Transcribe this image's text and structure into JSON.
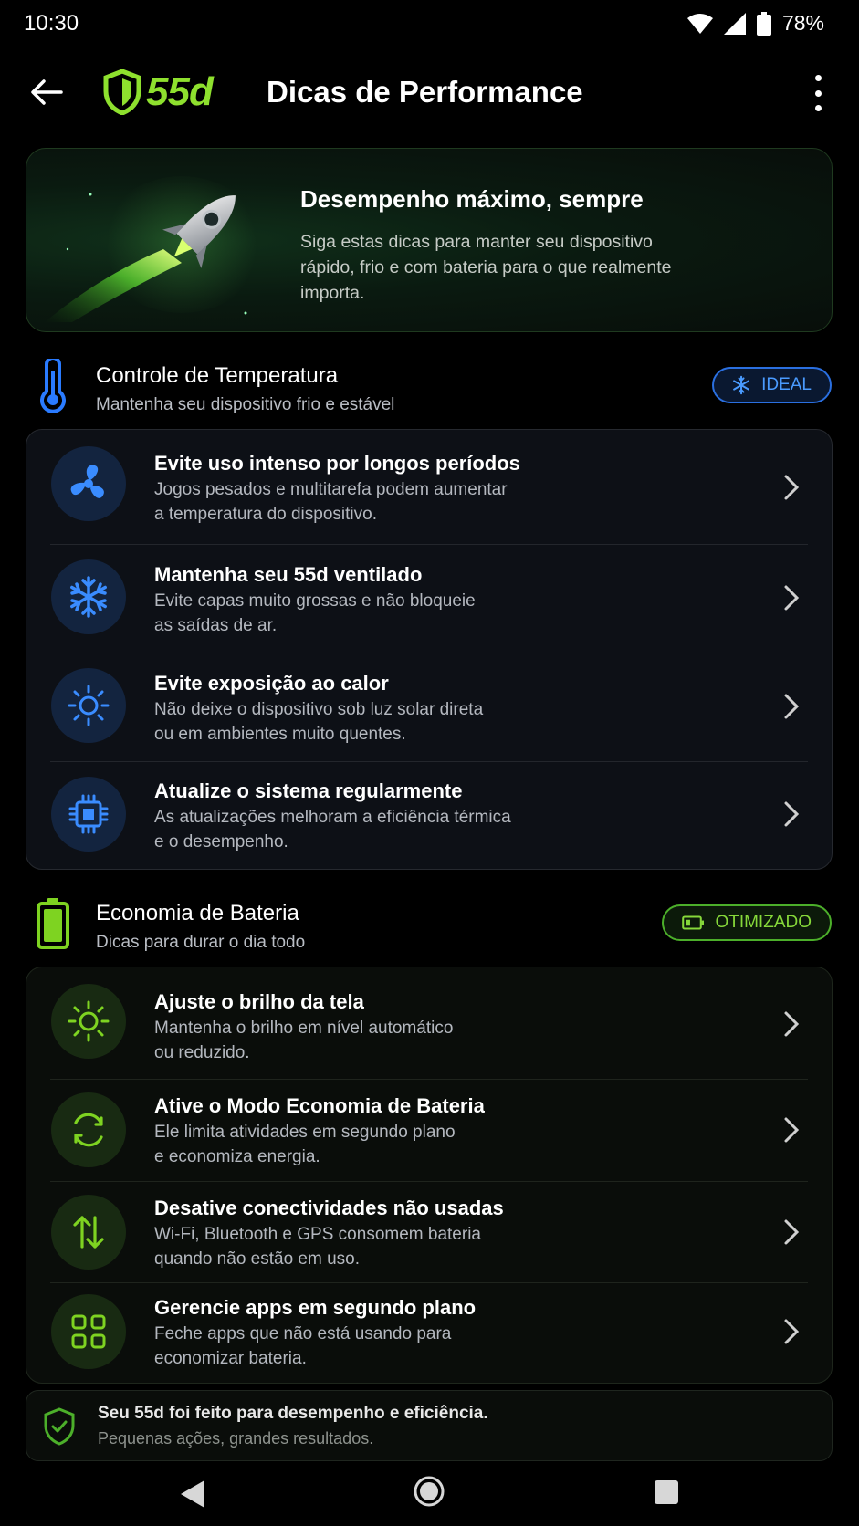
{
  "status_bar": {
    "time": "10:30",
    "battery": "78%"
  },
  "header": {
    "logo_text": "55d",
    "title": "Dicas de Performance"
  },
  "hero": {
    "title": "Desempenho máximo, sempre",
    "description": "Siga estas dicas para manter seu dispositivo rápido, frio e com bateria para o que realmente importa."
  },
  "temperature": {
    "title": "Controle de Temperatura",
    "subtitle": "Mantenha seu dispositivo frio e estável",
    "badge": "IDEAL",
    "accent": "#2a7bff",
    "items": [
      {
        "icon": "fan-icon",
        "title": "Evite uso intenso por longos períodos",
        "desc1": "Jogos pesados e multitarefa podem aumentar",
        "desc2": "a temperatura do dispositivo."
      },
      {
        "icon": "snowflake-icon",
        "title": "Mantenha seu 55d ventilado",
        "desc1": "Evite capas muito grossas e não bloqueie",
        "desc2": "as saídas de ar."
      },
      {
        "icon": "sun-icon",
        "title": "Evite exposição ao calor",
        "desc1": "Não deixe o dispositivo sob luz solar direta",
        "desc2": "ou em ambientes muito quentes."
      },
      {
        "icon": "chip-icon",
        "title": "Atualize o sistema regularmente",
        "desc1": "As atualizações melhoram a eficiência térmica",
        "desc2": "e o desempenho."
      }
    ]
  },
  "battery": {
    "title": "Economia de Bateria",
    "subtitle": "Dicas para durar o dia todo",
    "badge": "OTIMIZADO",
    "accent": "#7ed321",
    "items": [
      {
        "icon": "brightness-icon",
        "title": "Ajuste o brilho da tela",
        "desc1": "Mantenha o brilho em nível automático",
        "desc2": "ou reduzido."
      },
      {
        "icon": "sync-icon",
        "title": "Ative o Modo Economia de Bateria",
        "desc1": "Ele limita atividades em segundo plano",
        "desc2": "e economiza energia."
      },
      {
        "icon": "transfer-arrows-icon",
        "title": "Desative conectividades não usadas",
        "desc1": "Wi-Fi, Bluetooth e GPS consomem bateria",
        "desc2": "quando não estão em uso."
      },
      {
        "icon": "apps-grid-icon",
        "title": "Gerencie apps em segundo plano",
        "desc1": "Feche apps que não está usando para",
        "desc2": "economizar bateria."
      }
    ]
  },
  "footer_note": {
    "title": "Seu 55d foi feito para desempenho e eficiência.",
    "subtitle": "Pequenas ações, grandes resultados."
  }
}
